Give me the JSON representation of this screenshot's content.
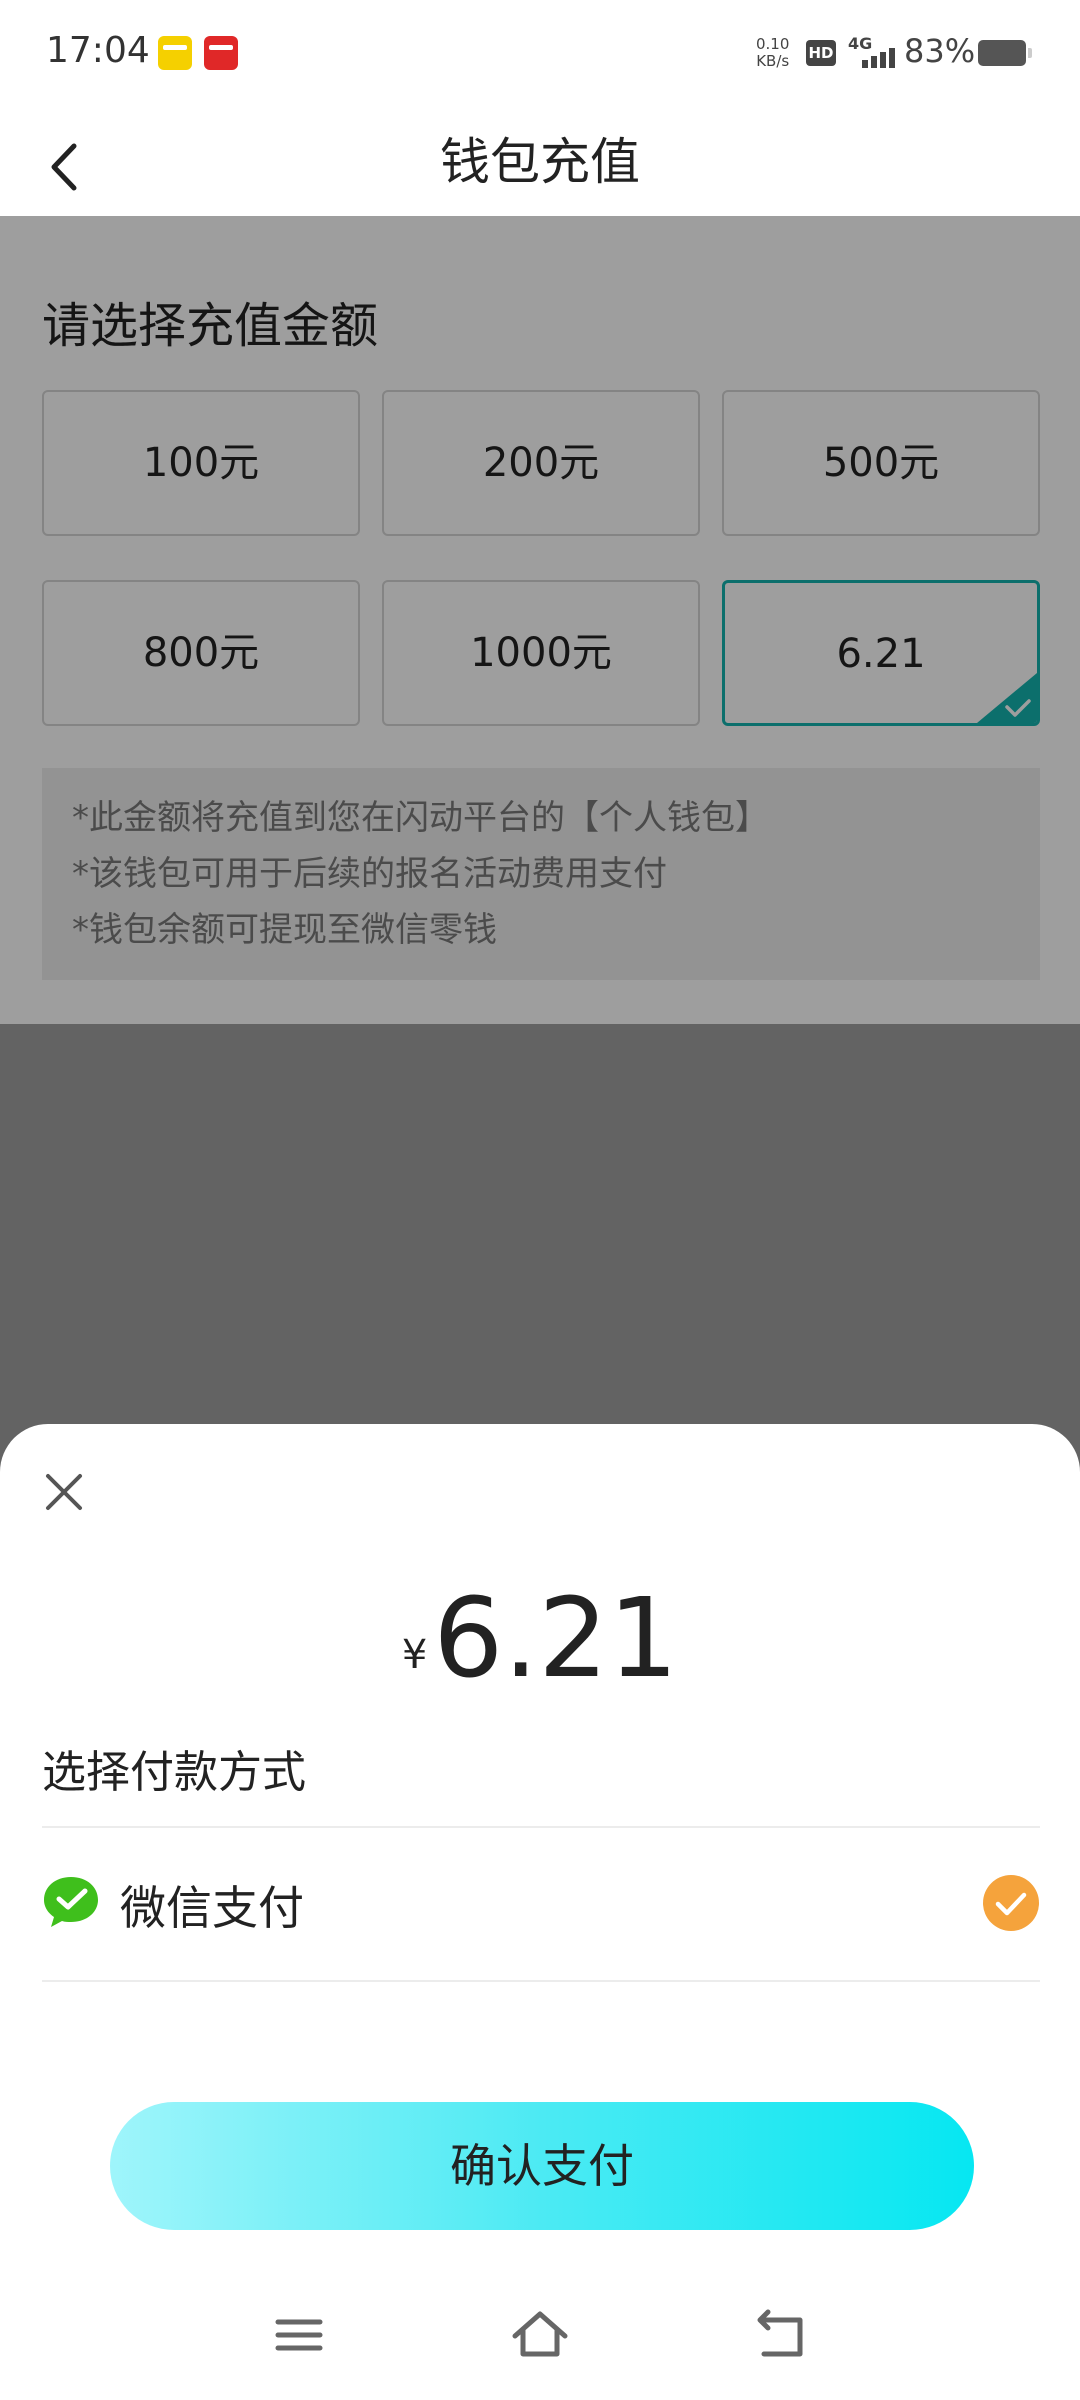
{
  "status_bar": {
    "time": "17:04",
    "net_speed_value": "0.10",
    "net_speed_unit": "KB/s",
    "hd_label": "HD",
    "network": "4G",
    "battery_percent": "83%",
    "battery_level": 0.83
  },
  "header": {
    "title": "钱包充值",
    "back_icon": "chevron-left-icon"
  },
  "recharge": {
    "section_title": "请选择充值金额",
    "options": [
      {
        "label": "100元",
        "selected": false
      },
      {
        "label": "200元",
        "selected": false
      },
      {
        "label": "500元",
        "selected": false
      },
      {
        "label": "800元",
        "selected": false
      },
      {
        "label": "1000元",
        "selected": false
      },
      {
        "label": "6.21",
        "selected": true
      }
    ],
    "notes": [
      "*此金额将充值到您在闪动平台的【个人钱包】",
      "*该钱包可用于后续的报名活动费用支付",
      "*钱包余额可提现至微信零钱"
    ]
  },
  "payment_sheet": {
    "currency_symbol": "¥",
    "amount": "6.21",
    "method_label": "选择付款方式",
    "methods": [
      {
        "name": "微信支付",
        "icon": "wechat-pay-icon",
        "selected": true
      }
    ],
    "confirm_label": "确认支付"
  },
  "colors": {
    "accent_teal": "#14b3ae",
    "check_orange": "#f5a33c",
    "wechat_green": "#3fbf1c",
    "confirm_gradient_start": "#9ff5fb",
    "confirm_gradient_end": "#06e7f2"
  },
  "system_nav": {
    "icons": [
      "menu-icon",
      "home-icon",
      "back-icon"
    ]
  }
}
